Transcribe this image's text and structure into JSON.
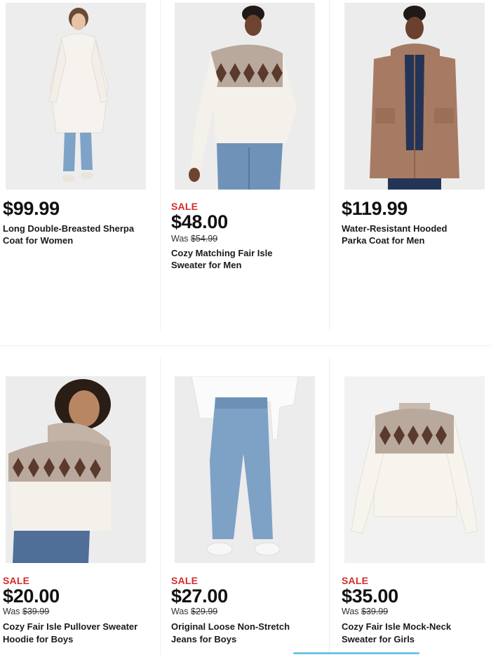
{
  "products": [
    {
      "sale_label": "",
      "price": "$99.99",
      "was_prefix": "",
      "was_price": "",
      "name_line1": "Long Double-Breasted Sherpa",
      "name_line2": "Coat for Women"
    },
    {
      "sale_label": "SALE",
      "price": "$48.00",
      "was_prefix": "Was ",
      "was_price": "$54.99",
      "name_line1": "Cozy Matching Fair Isle",
      "name_line2": "Sweater for Men"
    },
    {
      "sale_label": "",
      "price": "$119.99",
      "was_prefix": "",
      "was_price": "",
      "name_line1": "Water-Resistant Hooded",
      "name_line2": "Parka Coat for Men"
    },
    {
      "sale_label": "SALE",
      "price": "$20.00",
      "was_prefix": "Was ",
      "was_price": "$39.99",
      "name_line1": "Cozy Fair Isle Pullover Sweater",
      "name_line2": "Hoodie for Boys"
    },
    {
      "sale_label": "SALE",
      "price": "$27.00",
      "was_prefix": "Was ",
      "was_price": "$29.99",
      "name_line1": "Original Loose Non-Stretch",
      "name_line2": "Jeans for Boys"
    },
    {
      "sale_label": "SALE",
      "price": "$35.00",
      "was_prefix": "Was ",
      "was_price": "$39.99",
      "name_line1": "Cozy Fair Isle Mock-Neck",
      "name_line2": "Sweater for Girls"
    }
  ],
  "colors": {
    "sale": "#d52b2b",
    "divider": "#eceef1",
    "scroll_indicator": "#6ec6e8"
  }
}
